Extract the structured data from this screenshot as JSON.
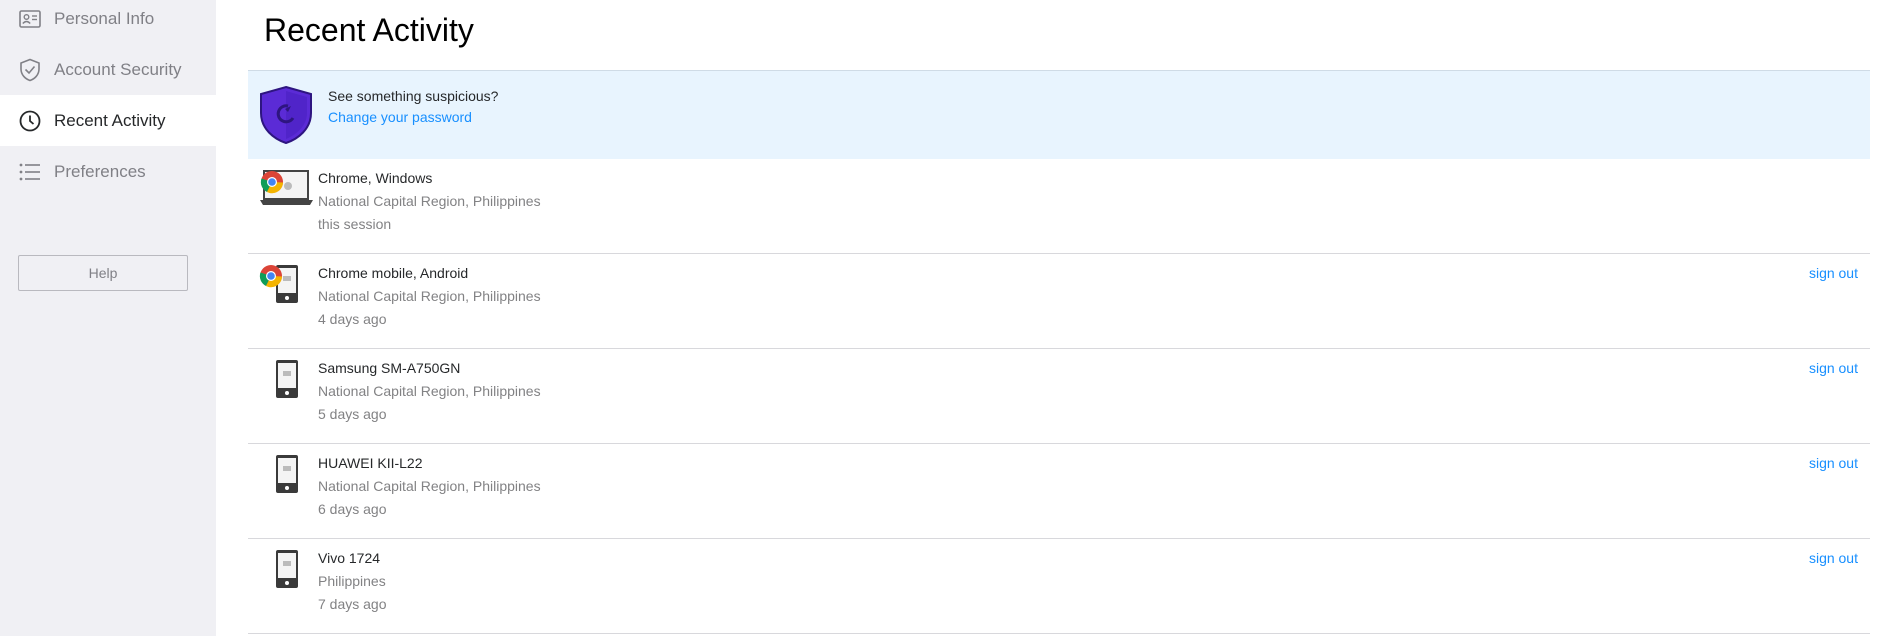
{
  "sidebar": {
    "items": [
      {
        "label": "Personal Info",
        "icon": "id-card-icon"
      },
      {
        "label": "Account Security",
        "icon": "shield-check-icon"
      },
      {
        "label": "Recent Activity",
        "icon": "clock-icon",
        "active": true
      },
      {
        "label": "Preferences",
        "icon": "list-icon"
      }
    ],
    "help_label": "Help"
  },
  "main": {
    "title": "Recent Activity",
    "alert": {
      "text": "See something suspicious?",
      "link": "Change your password",
      "icon": "shield-icon",
      "color": "#5b2bd6"
    },
    "sessions": [
      {
        "device": "Chrome, Windows",
        "location": "National Capital Region, Philippines",
        "time": "this session",
        "icon": "chrome-laptop-icon"
      },
      {
        "device": "Chrome mobile, Android",
        "location": "National Capital Region, Philippines",
        "time": "4 days ago",
        "action": "sign out",
        "icon": "chrome-phone-icon"
      },
      {
        "device": "Samsung SM-A750GN",
        "location": "National Capital Region, Philippines",
        "time": "5 days ago",
        "action": "sign out",
        "icon": "phone-icon"
      },
      {
        "device": "HUAWEI KII-L22",
        "location": "National Capital Region, Philippines",
        "time": "6 days ago",
        "action": "sign out",
        "icon": "phone-icon"
      },
      {
        "device": "Vivo 1724",
        "location": "Philippines",
        "time": "7 days ago",
        "action": "sign out",
        "icon": "phone-icon"
      }
    ]
  },
  "colors": {
    "link": "#188fff",
    "sidebar_bg": "#f0f0f4",
    "alert_bg": "#e8f4fe"
  }
}
